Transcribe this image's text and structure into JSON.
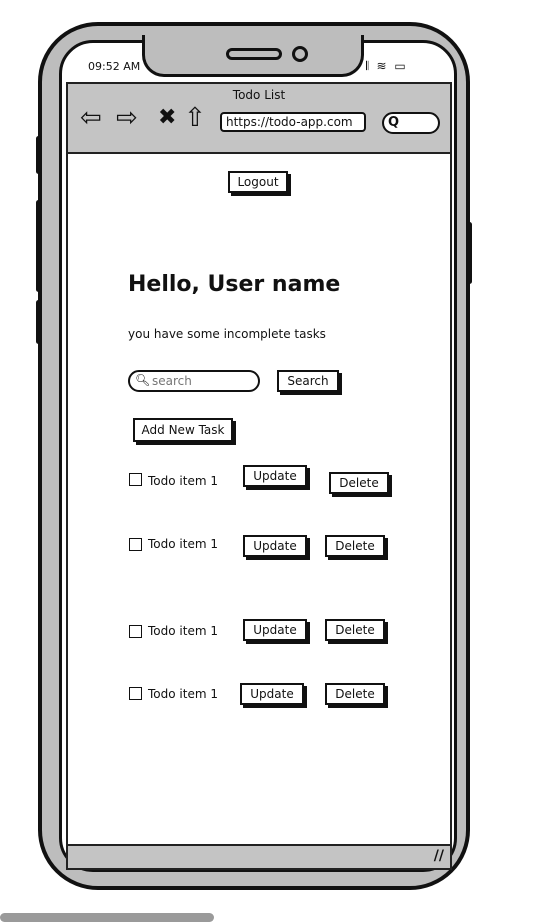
{
  "status_bar": {
    "time": "09:52 AM",
    "icons": "𝄃 ≋ ▭"
  },
  "browser": {
    "title": "Todo List",
    "back_glyph": "⇦",
    "forward_glyph": "⇨",
    "close_glyph": "✖",
    "home_glyph": "⇧",
    "url": "https://todo-app.com",
    "search_glyph": "Q"
  },
  "header": {
    "logout_label": "Logout"
  },
  "main": {
    "greeting": "Hello, User name",
    "subtitle": "you have some incomplete tasks",
    "search_placeholder": "search",
    "search_label": "Search",
    "add_task_label": "Add New Task"
  },
  "todos": [
    {
      "label": "Todo item 1",
      "update": "Update",
      "delete": "Delete"
    },
    {
      "label": "Todo item 1",
      "update": "Update",
      "delete": "Delete"
    },
    {
      "label": "Todo item 1",
      "update": "Update",
      "delete": "Delete"
    },
    {
      "label": "Todo item 1",
      "update": "Update",
      "delete": "Delete"
    }
  ],
  "footer": {
    "resize_glyph": "//"
  }
}
